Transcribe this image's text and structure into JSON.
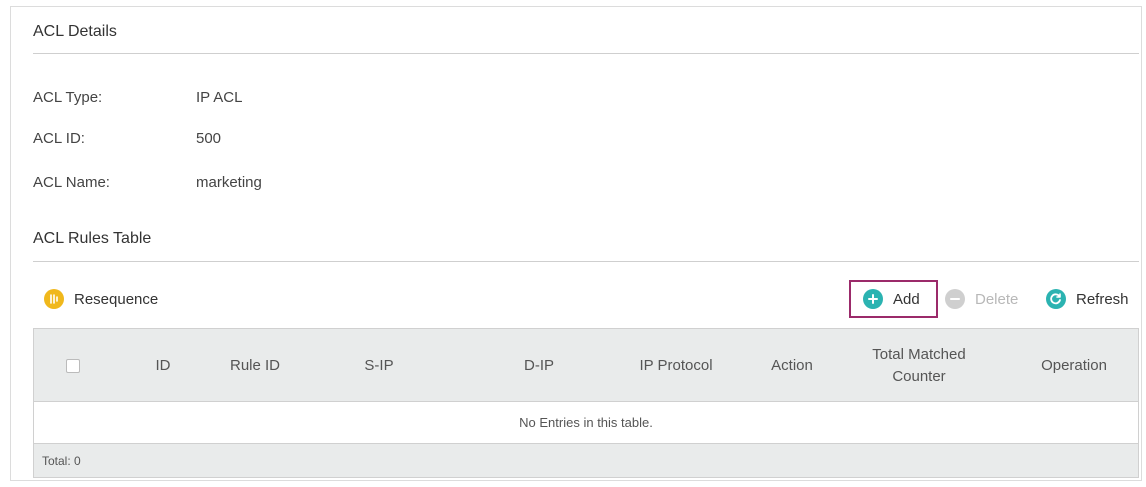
{
  "details": {
    "title": "ACL Details",
    "fields": [
      {
        "label": "ACL Type:",
        "value": "IP ACL"
      },
      {
        "label": "ACL ID:",
        "value": "500"
      },
      {
        "label": "ACL Name:",
        "value": "marketing"
      }
    ]
  },
  "rules": {
    "title": "ACL Rules Table",
    "toolbar": {
      "resequence": "Resequence",
      "add": "Add",
      "delete": "Delete",
      "refresh": "Refresh"
    },
    "columns": [
      "ID",
      "Rule ID",
      "S-IP",
      "D-IP",
      "IP Protocol",
      "Action",
      "Total Matched Counter",
      "Operation"
    ],
    "empty_message": "No Entries in this table.",
    "total": "Total: 0"
  },
  "colors": {
    "resequence_icon": "#f0b81c",
    "add_icon": "#2bb3b1",
    "refresh_icon": "#2bb3b1",
    "delete_icon": "#cfcfcf",
    "highlight": "#9b2a6a"
  },
  "icons": {
    "resequence": "resequence-icon",
    "add": "plus-circle-icon",
    "delete": "minus-circle-icon",
    "refresh": "refresh-icon"
  }
}
